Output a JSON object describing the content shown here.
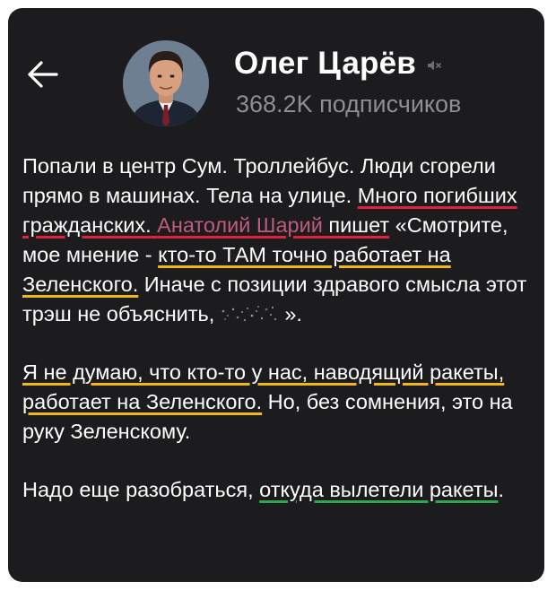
{
  "header": {
    "back_icon": "arrow-left-icon",
    "channel_name": "Олег Царёв",
    "mute_icon": "speaker-muted-icon",
    "subscribers": "368.2K подписчиков"
  },
  "post": {
    "p1_a": "Попали в центр Сум. Троллейбус. Люди сгорели прямо в машинах. Тела на улице. ",
    "p1_red": "Много погибших гражданских.",
    "p1_space": " ",
    "p1_link": "Анатолий Шарий",
    "p1_write": " пишет",
    "p1_quote_start": " «Смотрите, мое мнение - ",
    "p1_yellow": "кто-то ТАМ точно работает на Зеленского.",
    "p1_end": " Иначе с позиции здравого смысла этот трэш не объяснить,",
    "p1_close": "».",
    "p2_yellow": "Я не думаю, что кто-то у нас,  наводящий ракеты, работает на Зеленского.",
    "p2_end": " Но, без сомнения, это на руку Зеленскому.",
    "p3_a": "Надо еще разобраться, ",
    "p3_green": "откуда вылетели ракеты",
    "p3_end": "."
  },
  "colors": {
    "card_bg": "#1c1c1e",
    "text": "#ffffff",
    "subtle": "#8e8e93",
    "link": "#bf5b7c",
    "underline_red": "#e0213f",
    "underline_yellow": "#f2b618",
    "underline_green": "#2aa84a"
  }
}
